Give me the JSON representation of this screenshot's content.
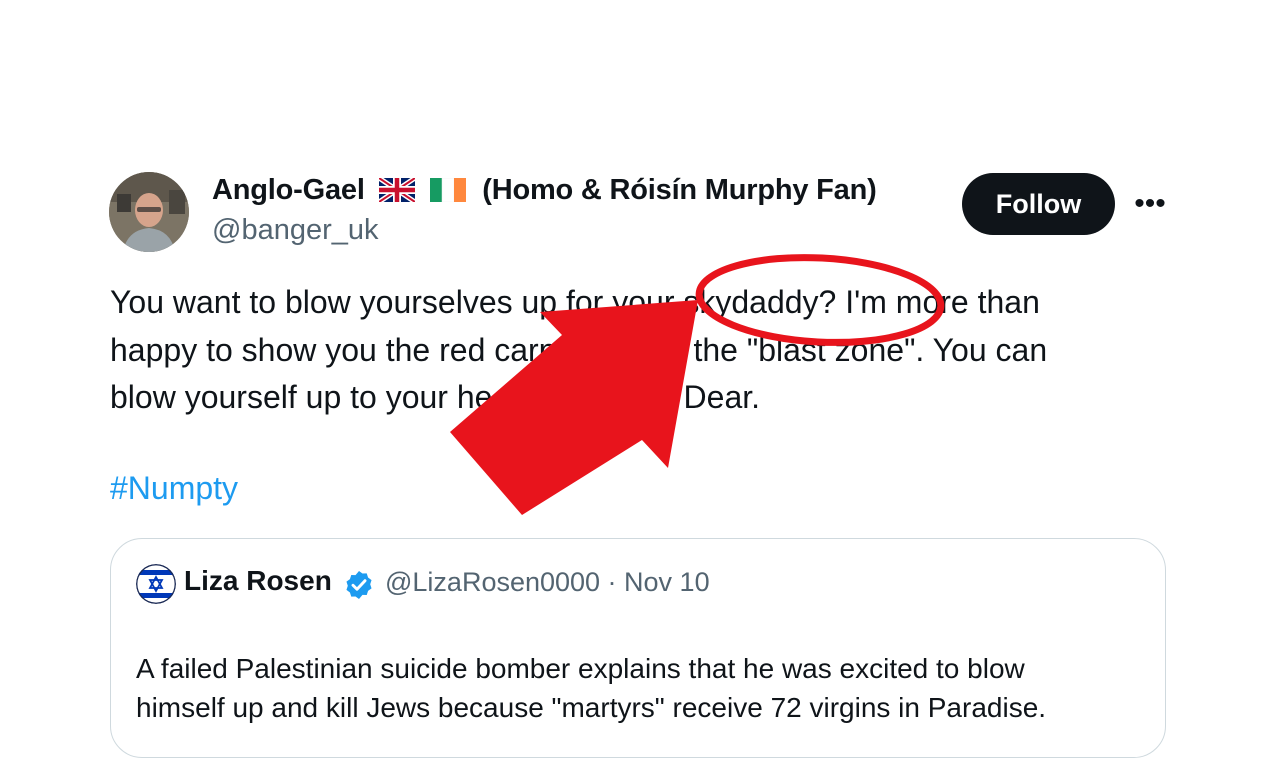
{
  "author": {
    "display_name_before": "Anglo-Gael",
    "display_name_after": "(Homo & Róisín Murphy Fan)",
    "flags": [
      "uk-flag-icon",
      "ireland-flag-icon"
    ],
    "handle": "@banger_uk"
  },
  "follow_label": "Follow",
  "more_label": "•••",
  "tweet": {
    "lines": [
      "You want to blow yourselves up for your skydaddy? I'm more than",
      "happy to show you the red carpet way to the \"blast zone\". You can",
      "blow yourself up to your heart's content, Dear."
    ],
    "hashtag": "#Numpty"
  },
  "quoted": {
    "name": "Liza Rosen",
    "handle_and_date": "@LizaRosen0000 · Nov 10",
    "lines": [
      "A failed Palestinian suicide bomber explains that he was excited to blow",
      "himself up and kill Jews because \"martyrs\" receive 72 virgins in Paradise."
    ]
  },
  "overlay": {
    "highlight_color": "#e8141c",
    "arrow_color": "#e8141c",
    "highlighted_word": "skydaddy?"
  },
  "colors": {
    "link": "#1d9bf0",
    "secondary_text": "#536471",
    "verified": "#1d9bf0",
    "button_bg": "#0f1419"
  }
}
